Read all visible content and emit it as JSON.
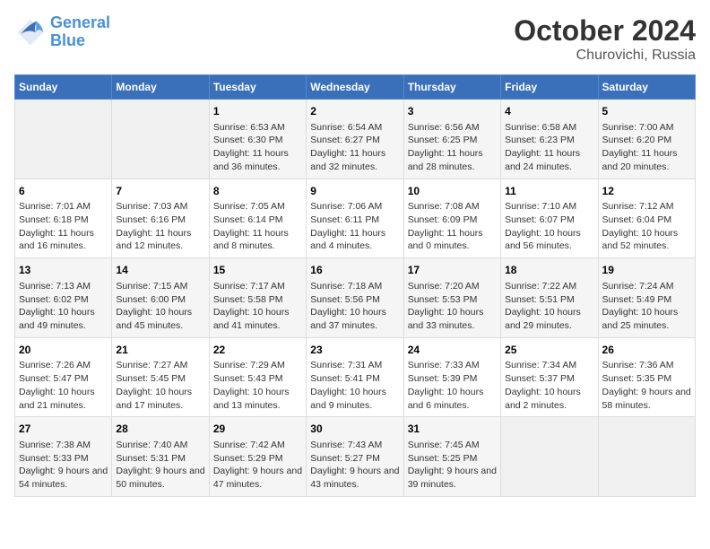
{
  "header": {
    "logo_general": "General",
    "logo_blue": "Blue",
    "main_title": "October 2024",
    "subtitle": "Churovichi, Russia"
  },
  "days_of_week": [
    "Sunday",
    "Monday",
    "Tuesday",
    "Wednesday",
    "Thursday",
    "Friday",
    "Saturday"
  ],
  "weeks": [
    [
      {
        "num": "",
        "info": ""
      },
      {
        "num": "",
        "info": ""
      },
      {
        "num": "1",
        "info": "Sunrise: 6:53 AM\nSunset: 6:30 PM\nDaylight: 11 hours and 36 minutes."
      },
      {
        "num": "2",
        "info": "Sunrise: 6:54 AM\nSunset: 6:27 PM\nDaylight: 11 hours and 32 minutes."
      },
      {
        "num": "3",
        "info": "Sunrise: 6:56 AM\nSunset: 6:25 PM\nDaylight: 11 hours and 28 minutes."
      },
      {
        "num": "4",
        "info": "Sunrise: 6:58 AM\nSunset: 6:23 PM\nDaylight: 11 hours and 24 minutes."
      },
      {
        "num": "5",
        "info": "Sunrise: 7:00 AM\nSunset: 6:20 PM\nDaylight: 11 hours and 20 minutes."
      }
    ],
    [
      {
        "num": "6",
        "info": "Sunrise: 7:01 AM\nSunset: 6:18 PM\nDaylight: 11 hours and 16 minutes."
      },
      {
        "num": "7",
        "info": "Sunrise: 7:03 AM\nSunset: 6:16 PM\nDaylight: 11 hours and 12 minutes."
      },
      {
        "num": "8",
        "info": "Sunrise: 7:05 AM\nSunset: 6:14 PM\nDaylight: 11 hours and 8 minutes."
      },
      {
        "num": "9",
        "info": "Sunrise: 7:06 AM\nSunset: 6:11 PM\nDaylight: 11 hours and 4 minutes."
      },
      {
        "num": "10",
        "info": "Sunrise: 7:08 AM\nSunset: 6:09 PM\nDaylight: 11 hours and 0 minutes."
      },
      {
        "num": "11",
        "info": "Sunrise: 7:10 AM\nSunset: 6:07 PM\nDaylight: 10 hours and 56 minutes."
      },
      {
        "num": "12",
        "info": "Sunrise: 7:12 AM\nSunset: 6:04 PM\nDaylight: 10 hours and 52 minutes."
      }
    ],
    [
      {
        "num": "13",
        "info": "Sunrise: 7:13 AM\nSunset: 6:02 PM\nDaylight: 10 hours and 49 minutes."
      },
      {
        "num": "14",
        "info": "Sunrise: 7:15 AM\nSunset: 6:00 PM\nDaylight: 10 hours and 45 minutes."
      },
      {
        "num": "15",
        "info": "Sunrise: 7:17 AM\nSunset: 5:58 PM\nDaylight: 10 hours and 41 minutes."
      },
      {
        "num": "16",
        "info": "Sunrise: 7:18 AM\nSunset: 5:56 PM\nDaylight: 10 hours and 37 minutes."
      },
      {
        "num": "17",
        "info": "Sunrise: 7:20 AM\nSunset: 5:53 PM\nDaylight: 10 hours and 33 minutes."
      },
      {
        "num": "18",
        "info": "Sunrise: 7:22 AM\nSunset: 5:51 PM\nDaylight: 10 hours and 29 minutes."
      },
      {
        "num": "19",
        "info": "Sunrise: 7:24 AM\nSunset: 5:49 PM\nDaylight: 10 hours and 25 minutes."
      }
    ],
    [
      {
        "num": "20",
        "info": "Sunrise: 7:26 AM\nSunset: 5:47 PM\nDaylight: 10 hours and 21 minutes."
      },
      {
        "num": "21",
        "info": "Sunrise: 7:27 AM\nSunset: 5:45 PM\nDaylight: 10 hours and 17 minutes."
      },
      {
        "num": "22",
        "info": "Sunrise: 7:29 AM\nSunset: 5:43 PM\nDaylight: 10 hours and 13 minutes."
      },
      {
        "num": "23",
        "info": "Sunrise: 7:31 AM\nSunset: 5:41 PM\nDaylight: 10 hours and 9 minutes."
      },
      {
        "num": "24",
        "info": "Sunrise: 7:33 AM\nSunset: 5:39 PM\nDaylight: 10 hours and 6 minutes."
      },
      {
        "num": "25",
        "info": "Sunrise: 7:34 AM\nSunset: 5:37 PM\nDaylight: 10 hours and 2 minutes."
      },
      {
        "num": "26",
        "info": "Sunrise: 7:36 AM\nSunset: 5:35 PM\nDaylight: 9 hours and 58 minutes."
      }
    ],
    [
      {
        "num": "27",
        "info": "Sunrise: 7:38 AM\nSunset: 5:33 PM\nDaylight: 9 hours and 54 minutes."
      },
      {
        "num": "28",
        "info": "Sunrise: 7:40 AM\nSunset: 5:31 PM\nDaylight: 9 hours and 50 minutes."
      },
      {
        "num": "29",
        "info": "Sunrise: 7:42 AM\nSunset: 5:29 PM\nDaylight: 9 hours and 47 minutes."
      },
      {
        "num": "30",
        "info": "Sunrise: 7:43 AM\nSunset: 5:27 PM\nDaylight: 9 hours and 43 minutes."
      },
      {
        "num": "31",
        "info": "Sunrise: 7:45 AM\nSunset: 5:25 PM\nDaylight: 9 hours and 39 minutes."
      },
      {
        "num": "",
        "info": ""
      },
      {
        "num": "",
        "info": ""
      }
    ]
  ]
}
